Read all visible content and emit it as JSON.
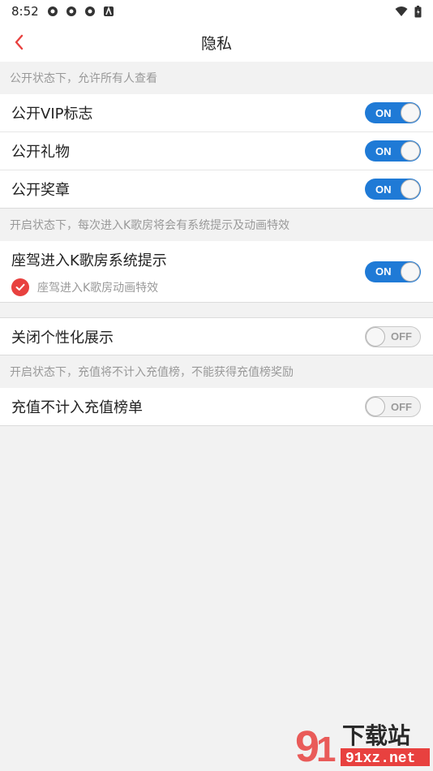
{
  "status_bar": {
    "time": "8:52"
  },
  "header": {
    "title": "隐私"
  },
  "sections": {
    "public": {
      "note": "公开状态下，允许所有人查看",
      "items": [
        {
          "label": "公开VIP标志",
          "state": "ON"
        },
        {
          "label": "公开礼物",
          "state": "ON"
        },
        {
          "label": "公开奖章",
          "state": "ON"
        }
      ]
    },
    "entry": {
      "note": "开启状态下，每次进入K歌房将会有系统提示及动画特效",
      "main_label": "座驾进入K歌房系统提示",
      "sub_label": "座驾进入K歌房动画特效",
      "state": "ON"
    },
    "personal": {
      "label": "关闭个性化展示",
      "state": "OFF"
    },
    "recharge": {
      "note": "开启状态下，充值将不计入充值榜，不能获得充值榜奖励",
      "label": "充值不计入充值榜单",
      "state": "OFF"
    }
  },
  "colors": {
    "accent": "#1f7ad6",
    "check": "#e8413f",
    "back_arrow": "#e8413f"
  },
  "watermark": {
    "text": "下载站",
    "url_text": "91xz.net"
  }
}
